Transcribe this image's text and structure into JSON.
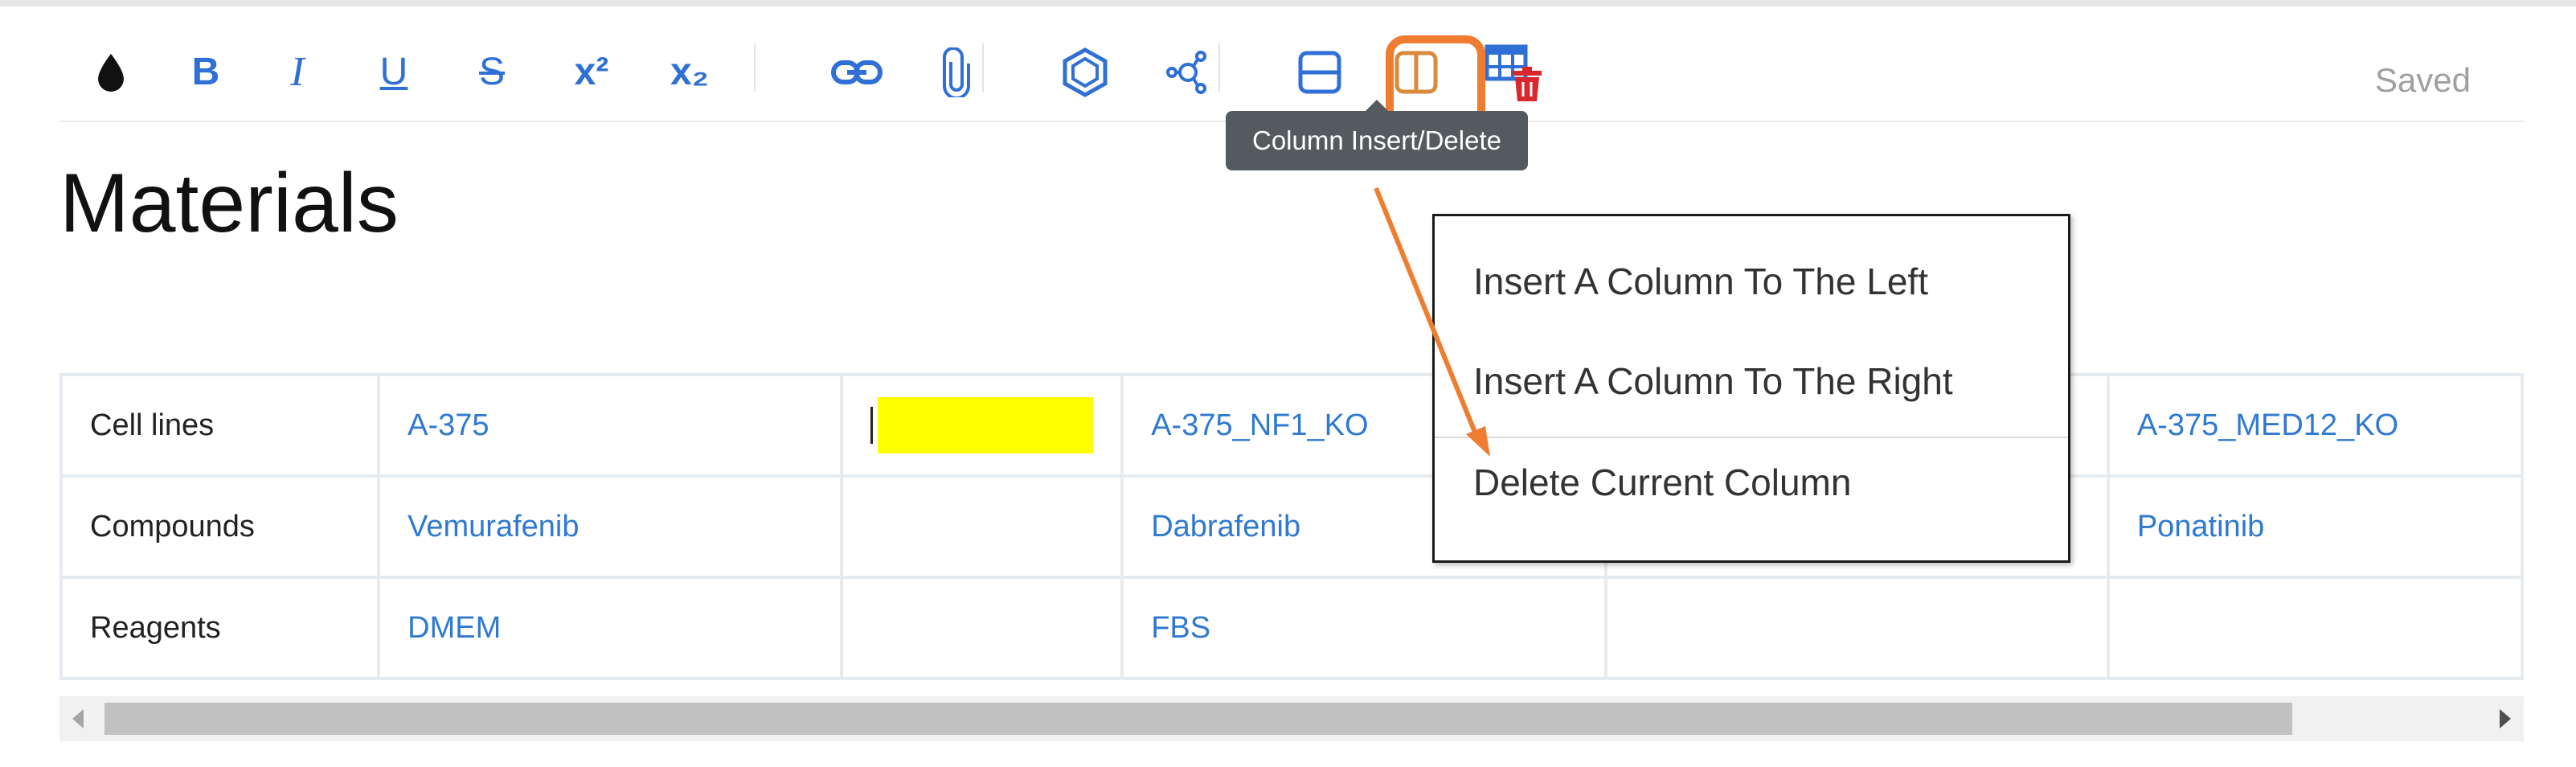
{
  "toolbar": {
    "buttons": [
      {
        "name": "color-drop-icon",
        "label": ""
      },
      {
        "name": "bold-button",
        "label": "B"
      },
      {
        "name": "italic-button",
        "label": "I"
      },
      {
        "name": "underline-button",
        "label": "U"
      },
      {
        "name": "strikethrough-button",
        "label": "S"
      },
      {
        "name": "superscript-button",
        "label": "x²"
      },
      {
        "name": "subscript-button",
        "label": "x₂"
      },
      {
        "name": "link-icon",
        "label": ""
      },
      {
        "name": "attachment-icon",
        "label": ""
      },
      {
        "name": "chemical-structure-icon",
        "label": ""
      },
      {
        "name": "molecule-network-icon",
        "label": ""
      },
      {
        "name": "row-insert-delete-icon",
        "label": ""
      },
      {
        "name": "column-insert-delete-icon",
        "label": ""
      },
      {
        "name": "table-delete-icon",
        "label": ""
      }
    ],
    "status": "Saved",
    "tooltip": "Column Insert/Delete"
  },
  "colors": {
    "accent": "#2f6fd6",
    "highlight": "#ee7d31",
    "delete_red": "#d9272e",
    "yellow_cell": "#ffff00",
    "tooltip_bg": "#555a5f"
  },
  "page": {
    "title": "Materials"
  },
  "table": {
    "rows": [
      {
        "label": "Cell lines",
        "cells": [
          "A-375",
          "",
          "A-375_NF1_KO",
          "",
          "A-375_MED12_KO"
        ]
      },
      {
        "label": "Compounds",
        "cells": [
          "Vemurafenib",
          "",
          "Dabrafenib",
          "",
          "Ponatinib"
        ]
      },
      {
        "label": "Reagents",
        "cells": [
          "DMEM",
          "",
          "FBS",
          "",
          ""
        ]
      }
    ]
  },
  "context_menu": {
    "items": [
      "Insert A Column To The Left",
      "Insert A Column To The Right",
      "Delete Current Column"
    ]
  }
}
